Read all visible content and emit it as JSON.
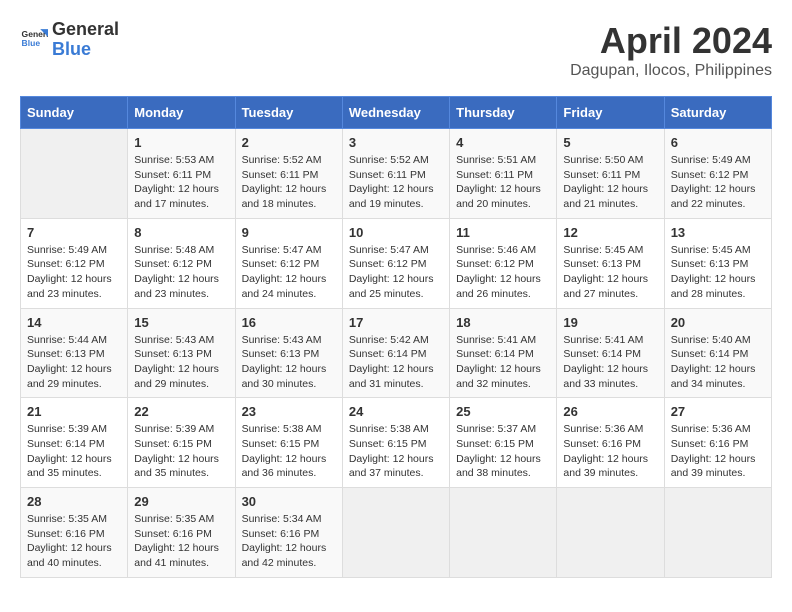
{
  "header": {
    "logo_line1": "General",
    "logo_line2": "Blue",
    "month": "April 2024",
    "location": "Dagupan, Ilocos, Philippines"
  },
  "weekdays": [
    "Sunday",
    "Monday",
    "Tuesday",
    "Wednesday",
    "Thursday",
    "Friday",
    "Saturday"
  ],
  "weeks": [
    [
      {
        "day": "",
        "sunrise": "",
        "sunset": "",
        "daylight": ""
      },
      {
        "day": "1",
        "sunrise": "Sunrise: 5:53 AM",
        "sunset": "Sunset: 6:11 PM",
        "daylight": "Daylight: 12 hours and 17 minutes."
      },
      {
        "day": "2",
        "sunrise": "Sunrise: 5:52 AM",
        "sunset": "Sunset: 6:11 PM",
        "daylight": "Daylight: 12 hours and 18 minutes."
      },
      {
        "day": "3",
        "sunrise": "Sunrise: 5:52 AM",
        "sunset": "Sunset: 6:11 PM",
        "daylight": "Daylight: 12 hours and 19 minutes."
      },
      {
        "day": "4",
        "sunrise": "Sunrise: 5:51 AM",
        "sunset": "Sunset: 6:11 PM",
        "daylight": "Daylight: 12 hours and 20 minutes."
      },
      {
        "day": "5",
        "sunrise": "Sunrise: 5:50 AM",
        "sunset": "Sunset: 6:11 PM",
        "daylight": "Daylight: 12 hours and 21 minutes."
      },
      {
        "day": "6",
        "sunrise": "Sunrise: 5:49 AM",
        "sunset": "Sunset: 6:12 PM",
        "daylight": "Daylight: 12 hours and 22 minutes."
      }
    ],
    [
      {
        "day": "7",
        "sunrise": "Sunrise: 5:49 AM",
        "sunset": "Sunset: 6:12 PM",
        "daylight": "Daylight: 12 hours and 23 minutes."
      },
      {
        "day": "8",
        "sunrise": "Sunrise: 5:48 AM",
        "sunset": "Sunset: 6:12 PM",
        "daylight": "Daylight: 12 hours and 23 minutes."
      },
      {
        "day": "9",
        "sunrise": "Sunrise: 5:47 AM",
        "sunset": "Sunset: 6:12 PM",
        "daylight": "Daylight: 12 hours and 24 minutes."
      },
      {
        "day": "10",
        "sunrise": "Sunrise: 5:47 AM",
        "sunset": "Sunset: 6:12 PM",
        "daylight": "Daylight: 12 hours and 25 minutes."
      },
      {
        "day": "11",
        "sunrise": "Sunrise: 5:46 AM",
        "sunset": "Sunset: 6:12 PM",
        "daylight": "Daylight: 12 hours and 26 minutes."
      },
      {
        "day": "12",
        "sunrise": "Sunrise: 5:45 AM",
        "sunset": "Sunset: 6:13 PM",
        "daylight": "Daylight: 12 hours and 27 minutes."
      },
      {
        "day": "13",
        "sunrise": "Sunrise: 5:45 AM",
        "sunset": "Sunset: 6:13 PM",
        "daylight": "Daylight: 12 hours and 28 minutes."
      }
    ],
    [
      {
        "day": "14",
        "sunrise": "Sunrise: 5:44 AM",
        "sunset": "Sunset: 6:13 PM",
        "daylight": "Daylight: 12 hours and 29 minutes."
      },
      {
        "day": "15",
        "sunrise": "Sunrise: 5:43 AM",
        "sunset": "Sunset: 6:13 PM",
        "daylight": "Daylight: 12 hours and 29 minutes."
      },
      {
        "day": "16",
        "sunrise": "Sunrise: 5:43 AM",
        "sunset": "Sunset: 6:13 PM",
        "daylight": "Daylight: 12 hours and 30 minutes."
      },
      {
        "day": "17",
        "sunrise": "Sunrise: 5:42 AM",
        "sunset": "Sunset: 6:14 PM",
        "daylight": "Daylight: 12 hours and 31 minutes."
      },
      {
        "day": "18",
        "sunrise": "Sunrise: 5:41 AM",
        "sunset": "Sunset: 6:14 PM",
        "daylight": "Daylight: 12 hours and 32 minutes."
      },
      {
        "day": "19",
        "sunrise": "Sunrise: 5:41 AM",
        "sunset": "Sunset: 6:14 PM",
        "daylight": "Daylight: 12 hours and 33 minutes."
      },
      {
        "day": "20",
        "sunrise": "Sunrise: 5:40 AM",
        "sunset": "Sunset: 6:14 PM",
        "daylight": "Daylight: 12 hours and 34 minutes."
      }
    ],
    [
      {
        "day": "21",
        "sunrise": "Sunrise: 5:39 AM",
        "sunset": "Sunset: 6:14 PM",
        "daylight": "Daylight: 12 hours and 35 minutes."
      },
      {
        "day": "22",
        "sunrise": "Sunrise: 5:39 AM",
        "sunset": "Sunset: 6:15 PM",
        "daylight": "Daylight: 12 hours and 35 minutes."
      },
      {
        "day": "23",
        "sunrise": "Sunrise: 5:38 AM",
        "sunset": "Sunset: 6:15 PM",
        "daylight": "Daylight: 12 hours and 36 minutes."
      },
      {
        "day": "24",
        "sunrise": "Sunrise: 5:38 AM",
        "sunset": "Sunset: 6:15 PM",
        "daylight": "Daylight: 12 hours and 37 minutes."
      },
      {
        "day": "25",
        "sunrise": "Sunrise: 5:37 AM",
        "sunset": "Sunset: 6:15 PM",
        "daylight": "Daylight: 12 hours and 38 minutes."
      },
      {
        "day": "26",
        "sunrise": "Sunrise: 5:36 AM",
        "sunset": "Sunset: 6:16 PM",
        "daylight": "Daylight: 12 hours and 39 minutes."
      },
      {
        "day": "27",
        "sunrise": "Sunrise: 5:36 AM",
        "sunset": "Sunset: 6:16 PM",
        "daylight": "Daylight: 12 hours and 39 minutes."
      }
    ],
    [
      {
        "day": "28",
        "sunrise": "Sunrise: 5:35 AM",
        "sunset": "Sunset: 6:16 PM",
        "daylight": "Daylight: 12 hours and 40 minutes."
      },
      {
        "day": "29",
        "sunrise": "Sunrise: 5:35 AM",
        "sunset": "Sunset: 6:16 PM",
        "daylight": "Daylight: 12 hours and 41 minutes."
      },
      {
        "day": "30",
        "sunrise": "Sunrise: 5:34 AM",
        "sunset": "Sunset: 6:16 PM",
        "daylight": "Daylight: 12 hours and 42 minutes."
      },
      {
        "day": "",
        "sunrise": "",
        "sunset": "",
        "daylight": ""
      },
      {
        "day": "",
        "sunrise": "",
        "sunset": "",
        "daylight": ""
      },
      {
        "day": "",
        "sunrise": "",
        "sunset": "",
        "daylight": ""
      },
      {
        "day": "",
        "sunrise": "",
        "sunset": "",
        "daylight": ""
      }
    ]
  ]
}
